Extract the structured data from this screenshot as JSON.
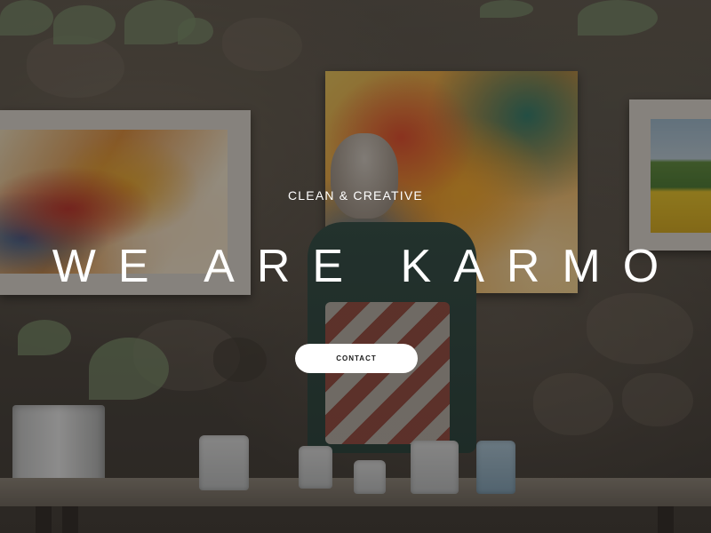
{
  "hero": {
    "tagline": "CLEAN & CREATIVE",
    "headline": "WE ARE KARMO",
    "contact_label": "CONTACT"
  },
  "colors": {
    "overlay": "#121010",
    "text": "#ffffff",
    "button_bg": "#ffffff",
    "button_text": "#1a1a1a"
  }
}
